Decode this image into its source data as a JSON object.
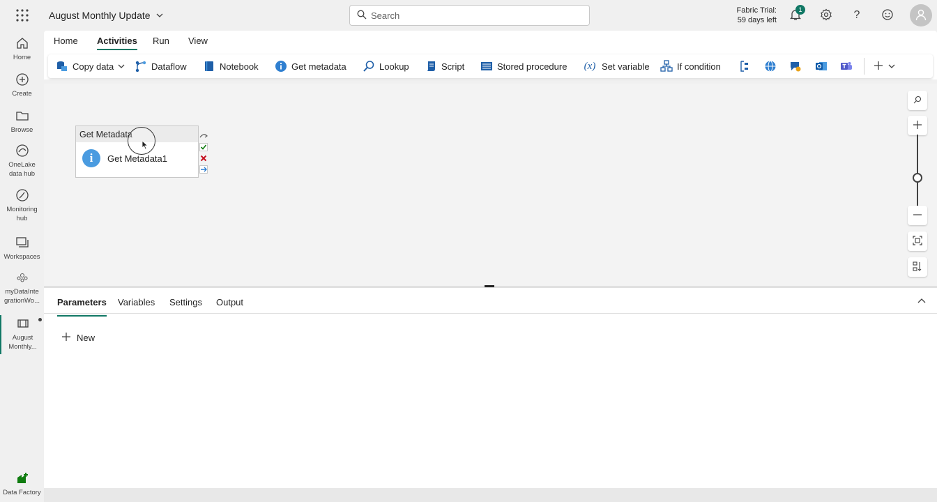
{
  "header": {
    "workspace_title": "August Monthly Update",
    "search_placeholder": "Search",
    "trial_line1": "Fabric Trial:",
    "trial_line2": "59 days left",
    "notification_count": "1"
  },
  "rail": {
    "items": [
      {
        "label": "Home"
      },
      {
        "label": "Create"
      },
      {
        "label": "Browse"
      },
      {
        "label": "OneLake data hub",
        "line1": "OneLake",
        "line2": "data hub"
      },
      {
        "label": "Monitoring hub",
        "line1": "Monitoring",
        "line2": "hub"
      },
      {
        "label": "Workspaces"
      },
      {
        "label": "myDataIntegrationWo...",
        "line1": "myDataInte",
        "line2": "grationWo..."
      },
      {
        "label": "August Monthly...",
        "line1": "August",
        "line2": "Monthly..."
      }
    ],
    "footer_label": "Data Factory"
  },
  "ribbon": {
    "tabs": [
      "Home",
      "Activities",
      "Run",
      "View"
    ],
    "active_tab": "Activities"
  },
  "toolbar": {
    "items": [
      {
        "label": "Copy data",
        "icon": "copy-data-icon"
      },
      {
        "label": "Dataflow",
        "icon": "dataflow-icon"
      },
      {
        "label": "Notebook",
        "icon": "notebook-icon"
      },
      {
        "label": "Get metadata",
        "icon": "info-icon"
      },
      {
        "label": "Lookup",
        "icon": "lookup-icon"
      },
      {
        "label": "Script",
        "icon": "script-icon"
      },
      {
        "label": "Stored procedure",
        "icon": "stored-procedure-icon"
      },
      {
        "label": "Set variable",
        "icon": "variable-icon"
      },
      {
        "label": "If condition",
        "icon": "if-condition-icon"
      }
    ]
  },
  "canvas": {
    "activity": {
      "type_label": "Get Metadata",
      "name": "Get Metadata1"
    }
  },
  "panel": {
    "tabs": [
      "Parameters",
      "Variables",
      "Settings",
      "Output"
    ],
    "active_tab": "Parameters",
    "new_label": "New"
  },
  "colors": {
    "accent": "#117865",
    "info_blue": "#4a9be0",
    "success_green": "#107c10",
    "failure_red": "#c50f1f"
  }
}
